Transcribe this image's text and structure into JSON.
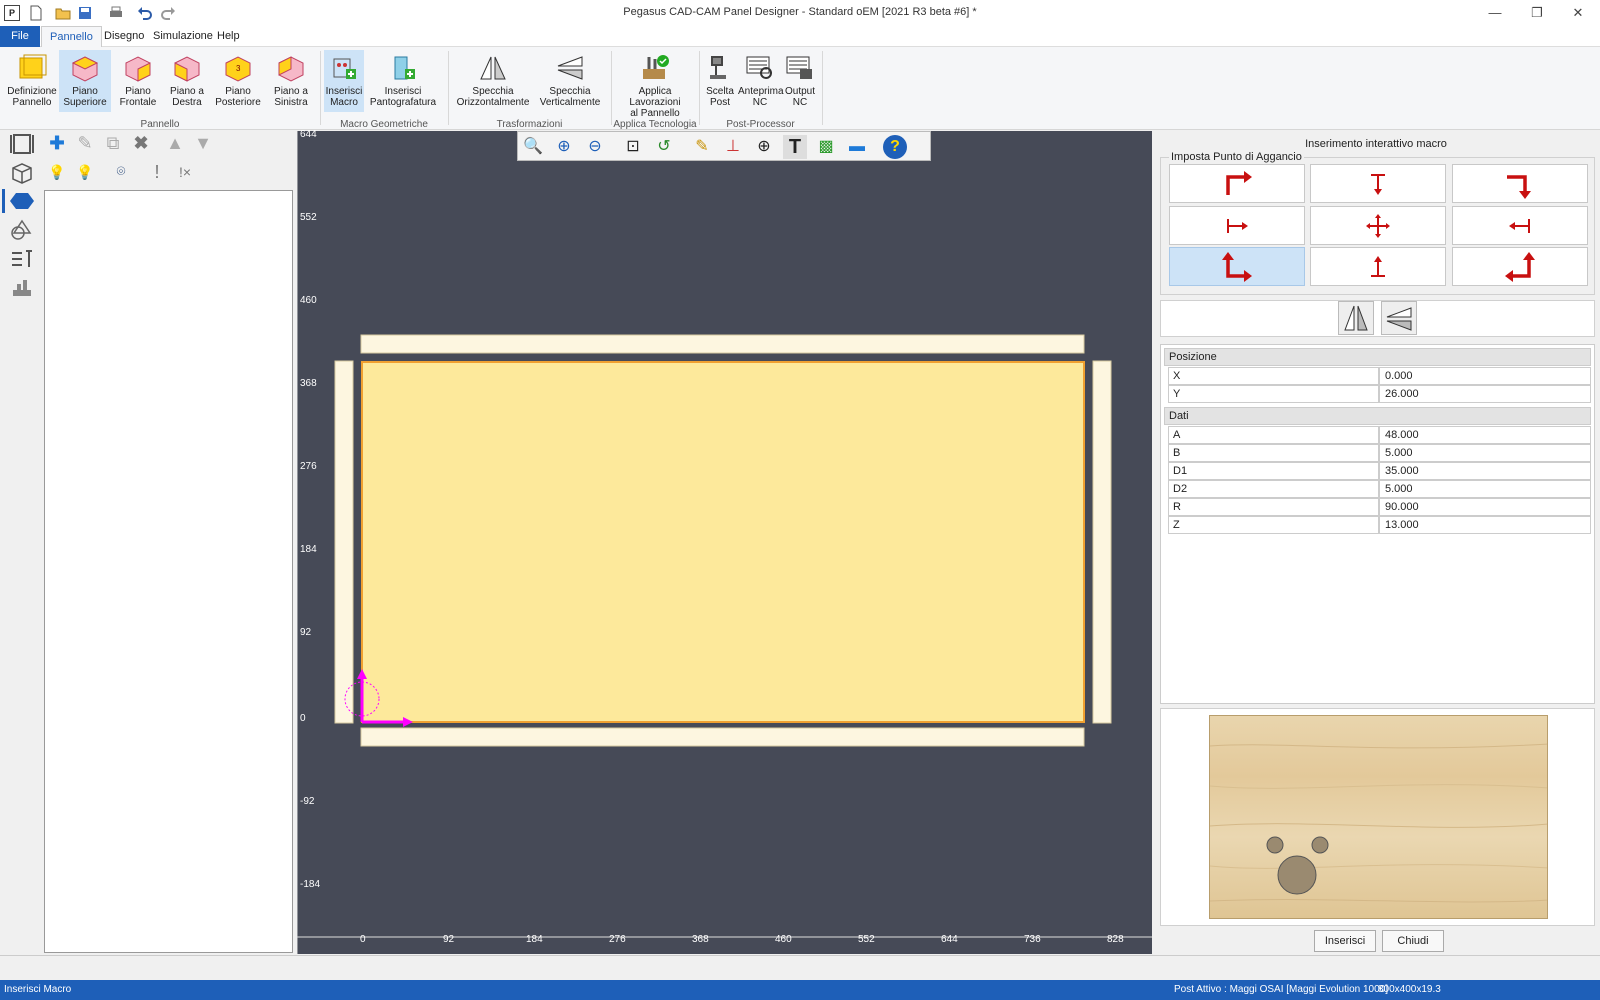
{
  "window": {
    "title": "Pegasus CAD-CAM Panel Designer - Standard oEM [2021 R3 beta #6] *"
  },
  "menu": {
    "file": "File",
    "pannello": "Pannello",
    "disegno": "Disegno",
    "simulazione": "Simulazione",
    "help": "Help"
  },
  "ribbon": {
    "buttons": [
      {
        "label1": "Definizione",
        "label2": "Pannello"
      },
      {
        "label1": "Piano",
        "label2": "Superiore"
      },
      {
        "label1": "Piano",
        "label2": "Frontale"
      },
      {
        "label1": "Piano a",
        "label2": "Destra"
      },
      {
        "label1": "Piano",
        "label2": "Posteriore"
      },
      {
        "label1": "Piano a",
        "label2": "Sinistra"
      },
      {
        "label1": "Inserisci",
        "label2": "Macro"
      },
      {
        "label1": "Inserisci",
        "label2": "Pantografatura"
      },
      {
        "label1": "Specchia",
        "label2": "Orizzontalmente"
      },
      {
        "label1": "Specchia",
        "label2": "Verticalmente"
      },
      {
        "label1": "Applica Lavorazioni",
        "label2": "al Pannello"
      },
      {
        "label1": "Scelta",
        "label2": "Post"
      },
      {
        "label1": "Anteprima",
        "label2": "NC"
      },
      {
        "label1": "Output",
        "label2": "NC"
      }
    ],
    "groups": {
      "pannello": "Pannello",
      "macro": "Macro Geometriche",
      "trasf": "Trasformazioni",
      "tecno": "Applica Tecnologia",
      "post": "Post-Processor"
    }
  },
  "canvas": {
    "v_ticks": [
      "644",
      "552",
      "460",
      "368",
      "276",
      "184",
      "92",
      "0",
      "-92",
      "-184"
    ],
    "h_ticks": [
      "0",
      "92",
      "184",
      "276",
      "368",
      "460",
      "552",
      "644",
      "736",
      "828"
    ]
  },
  "right_panel": {
    "title": "Inserimento interattivo macro",
    "hook_group": "Imposta Punto di Aggancio",
    "posizione_header": "Posizione",
    "posizione": [
      {
        "key": "X",
        "value": "0.000"
      },
      {
        "key": "Y",
        "value": "26.000"
      }
    ],
    "dati_header": "Dati",
    "dati": [
      {
        "key": "A",
        "value": "48.000"
      },
      {
        "key": "B",
        "value": "5.000"
      },
      {
        "key": "D1",
        "value": "35.000"
      },
      {
        "key": "D2",
        "value": "5.000"
      },
      {
        "key": "R",
        "value": "90.000"
      },
      {
        "key": "Z",
        "value": "13.000"
      }
    ],
    "insert_button": "Inserisci",
    "close_button": "Chiudi"
  },
  "status": {
    "left": "Inserisci Macro",
    "post": "Post Attivo : Maggi OSAI [Maggi Evolution 1000]",
    "dims": "800x400x19.3"
  },
  "colors": {
    "accent": "#1e5fb8",
    "panel_fill": "#fde99b",
    "panel_border": "#f0a030",
    "canvas_bg": "#464a57",
    "hook_arrow": "#c81010",
    "origin": "#ff00ff"
  }
}
